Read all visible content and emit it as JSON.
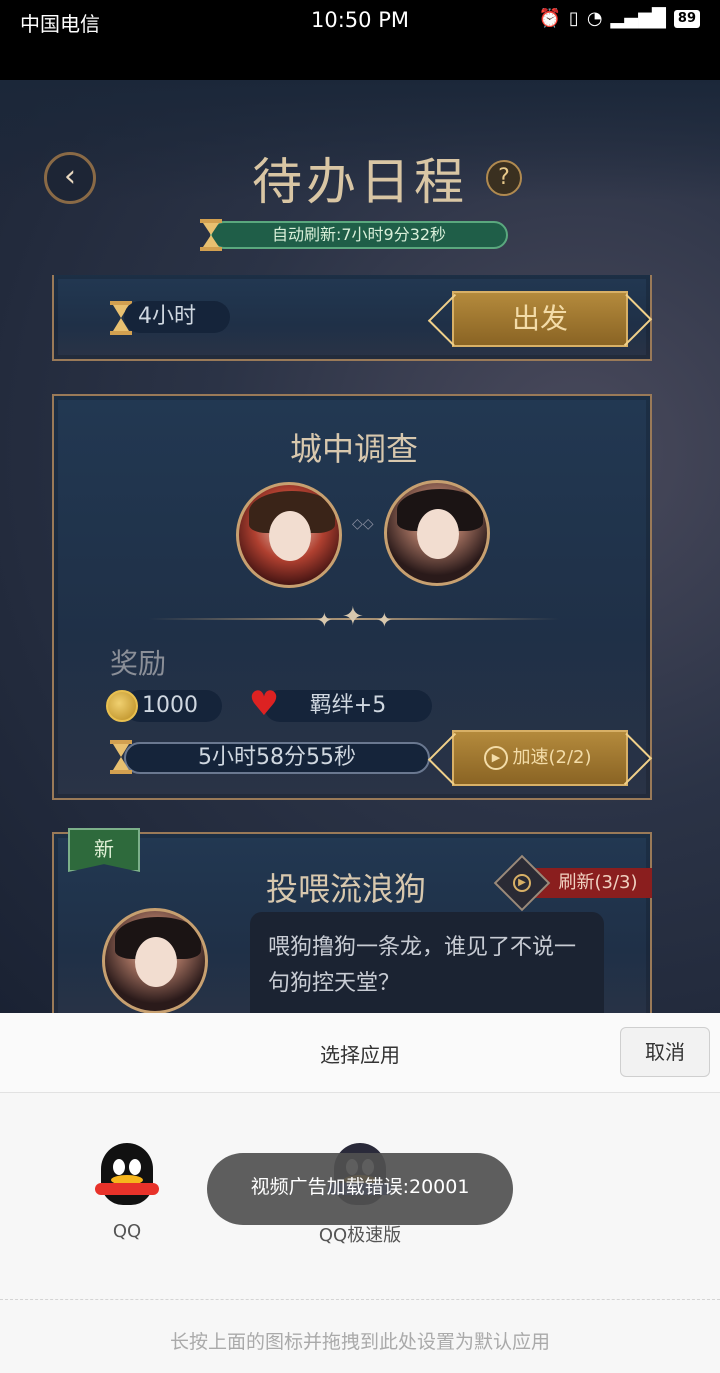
{
  "status_bar": {
    "carrier": "中国电信",
    "time": "10:50 PM",
    "battery": "89"
  },
  "header": {
    "title": "待办日程",
    "help": "?",
    "auto_refresh": "自动刷新:7小时9分32秒"
  },
  "card1": {
    "time": "4小时",
    "go_label": "出发"
  },
  "card2": {
    "title": "城中调查",
    "reward_label": "奖励",
    "coins": "1000",
    "bond": "羁绊+5",
    "countdown": "5小时58分55秒",
    "speedup_label": "加速(2/2)"
  },
  "card3": {
    "badge": "新",
    "title": "投喂流浪狗",
    "refresh_label": "刷新(3/3)",
    "description": "喂狗撸狗一条龙，谁见了不说一句狗控天堂？"
  },
  "chooser": {
    "title": "选择应用",
    "cancel": "取消",
    "apps": [
      {
        "label": "QQ"
      },
      {
        "label": "QQ极速版"
      }
    ],
    "hint": "长按上面的图标并拖拽到此处设置为默认应用"
  },
  "toast": "视频广告加载错误:20001"
}
